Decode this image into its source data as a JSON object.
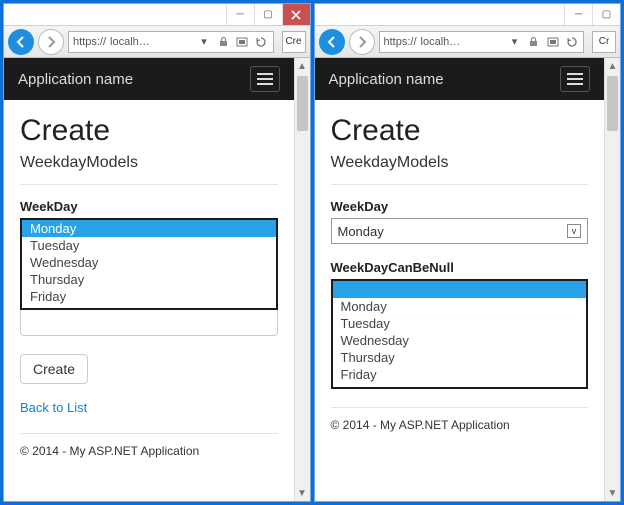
{
  "browser": {
    "url_scheme": "https://",
    "url_host": "localh…",
    "tab_label_left": "Cre",
    "tab_label_right": "Cr"
  },
  "app": {
    "name": "Application name"
  },
  "page": {
    "heading": "Create",
    "subheading": "WeekdayModels"
  },
  "left": {
    "field_label": "WeekDay",
    "options": [
      "Monday",
      "Tuesday",
      "Wednesday",
      "Thursday",
      "Friday"
    ],
    "selected_index": 0,
    "create_button": "Create",
    "back_link": "Back to List"
  },
  "right": {
    "field1_label": "WeekDay",
    "field1_value": "Monday",
    "field2_label": "WeekDayCanBeNull",
    "field2_options": [
      "",
      "Monday",
      "Tuesday",
      "Wednesday",
      "Thursday",
      "Friday"
    ],
    "field2_selected_index": 0
  },
  "footer": {
    "text": "© 2014 - My ASP.NET Application"
  }
}
